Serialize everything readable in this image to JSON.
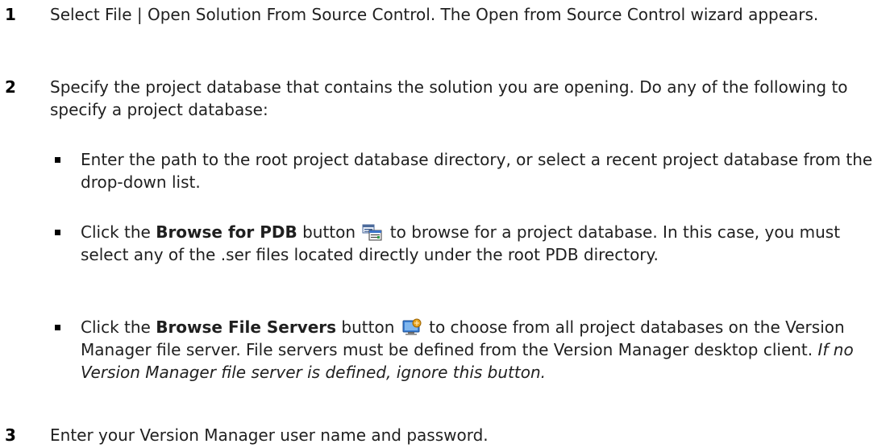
{
  "steps": [
    {
      "number": "1",
      "text": "Select File | Open Solution From Source Control. The Open from Source Control wizard appears."
    },
    {
      "number": "2",
      "text": "Specify the project database that contains the solution you are opening. Do any of the following to specify a project database:"
    },
    {
      "number": "3",
      "text": "Enter your Version Manager user name and password."
    }
  ],
  "bullets": {
    "b1": {
      "text": "Enter the path to the root project database directory, or select a recent project database from the drop-down list."
    },
    "b2": {
      "pre": "Click the ",
      "bold": "Browse for PDB",
      "mid": " button",
      "post": " to browse for a project database. In this case, you must select any of the .ser files located directly under the root PDB directory.",
      "icon": "browse-pdb-icon"
    },
    "b3": {
      "pre": "Click the ",
      "bold": "Browse File Servers",
      "mid": " button",
      "post": " to choose from all project databases on the Version Manager file server. File servers must be defined from the Version Manager desktop client. ",
      "italic": "If no Version Manager file server is defined, ignore this button.",
      "icon": "browse-file-servers-icon"
    }
  }
}
